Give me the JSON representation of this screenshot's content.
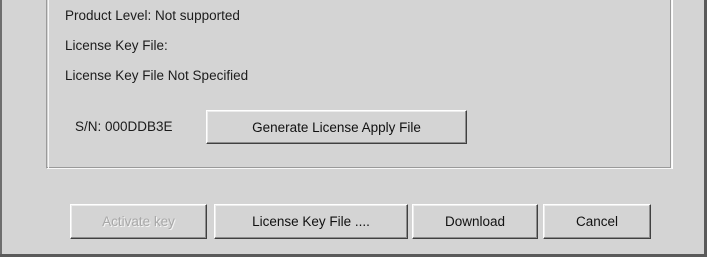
{
  "license_info": {
    "product_level": "Product Level: Not supported",
    "license_key_file_label": "License Key File:",
    "license_key_file_status": "License Key File Not Specified",
    "serial_number": "S/N: 000DDB3E"
  },
  "buttons": {
    "generate_apply_file": "Generate License Apply File",
    "activate_key": "Activate key",
    "license_key_file": "License Key File ....",
    "download": "Download",
    "cancel": "Cancel"
  },
  "state": {
    "activate_key_enabled": false
  }
}
